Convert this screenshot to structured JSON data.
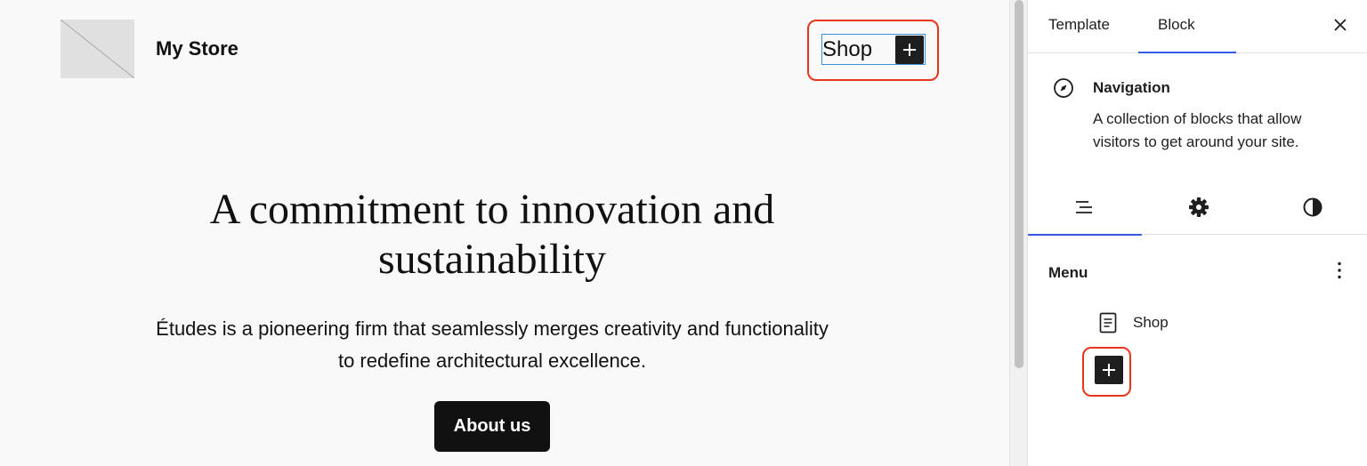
{
  "site": {
    "title": "My Store",
    "nav_items": [
      "Shop"
    ]
  },
  "hero": {
    "heading": "A commitment to innovation and sustainability",
    "text": "Études is a pioneering firm that seamlessly merges creativity and functionality to redefine architectural excellence.",
    "button_label": "About us"
  },
  "sidebar": {
    "tabs": [
      "Template",
      "Block"
    ],
    "active_tab": "Block",
    "block": {
      "icon": "compass-icon",
      "title": "Navigation",
      "description": "A collection of blocks that allow visitors to get around your site."
    },
    "sub_tabs": [
      {
        "icon": "list-view-icon",
        "active": true
      },
      {
        "icon": "gear-icon",
        "active": false
      },
      {
        "icon": "half-circle-contrast-icon",
        "active": false
      }
    ],
    "menu": {
      "label": "Menu",
      "items": [
        {
          "label": "Shop",
          "icon": "page-icon"
        }
      ]
    }
  },
  "colors": {
    "accent": "#3858e9",
    "highlight": "#e8351b",
    "selection": "#3b8ed8",
    "dark": "#1e1e1e"
  }
}
